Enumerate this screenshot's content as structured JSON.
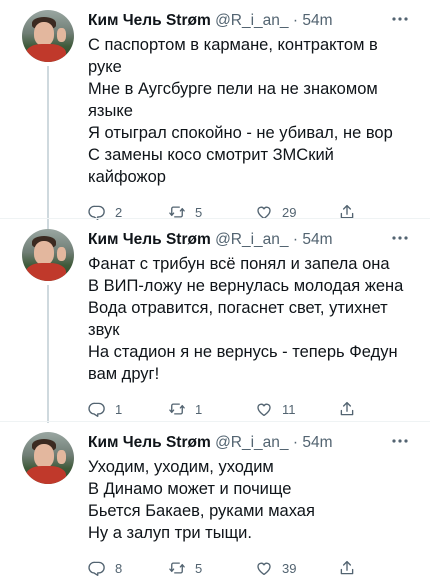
{
  "tweets": [
    {
      "author": "Ким Чель Strøm",
      "handle": "@R_i_an_",
      "separator": "·",
      "time": "54m",
      "lines": [
        "С паспортом в кармане, контрактом в",
        "руке",
        "Мне в Аугсбурге пели на не знакомом",
        "языке",
        "Я отыграл спокойно - не убивал, не вор",
        "С замены косо смотрит ЗМСкий",
        "кайфожор"
      ],
      "replies": "2",
      "retweets": "5",
      "likes": "29"
    },
    {
      "author": "Ким Чель Strøm",
      "handle": "@R_i_an_",
      "separator": "·",
      "time": "54m",
      "lines": [
        "Фанат с трибун всё понял и запела она",
        "В ВИП-ложу не вернулась молодая жена",
        "Вода отравится, погаснет свет, утихнет",
        "звук",
        "На стадион я не вернусь - теперь Федун",
        "вам друг!"
      ],
      "replies": "1",
      "retweets": "1",
      "likes": "11"
    },
    {
      "author": "Ким Чель Strøm",
      "handle": "@R_i_an_",
      "separator": "·",
      "time": "54m",
      "lines": [
        "Уходим, уходим, уходим",
        "В Динамо может и почище",
        "Бьется Бакаев, руками махая",
        "Ну а залуп три тыщи."
      ],
      "replies": "8",
      "retweets": "5",
      "likes": "39"
    }
  ],
  "icons": {
    "reply": "reply-icon",
    "retweet": "retweet-icon",
    "like": "like-icon",
    "share": "share-icon",
    "more": "more-icon"
  },
  "colors": {
    "text": "#0f1419",
    "secondary": "#536471",
    "thread_line": "#cfd9de",
    "divider": "#eff3f4"
  }
}
